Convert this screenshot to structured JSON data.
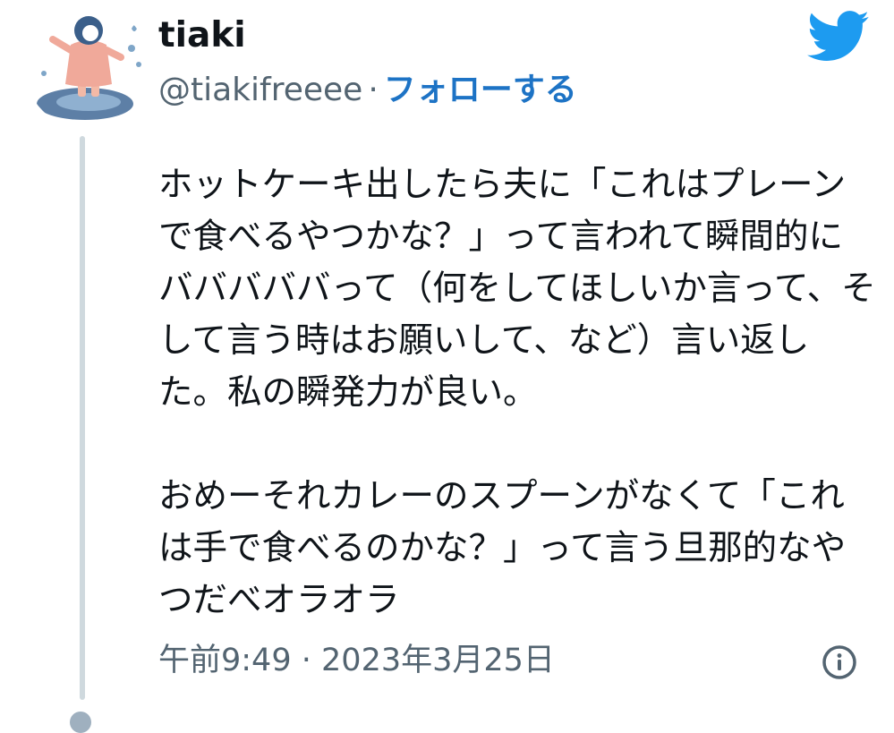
{
  "author": {
    "display_name": "tiaki",
    "handle": "@tiakifreeee",
    "separator": "·",
    "follow_label": "フォローする",
    "avatar_icon": "profile-avatar-girl-in-puddle"
  },
  "brand": {
    "logo_icon": "twitter-bird-icon",
    "color": "#1d9bf0"
  },
  "tweet": {
    "paragraph1": "ホットケーキ出したら夫に「これはプレーン\nで食べるやつかな？」って言われて瞬間的に\nバババババって（何をしてほしいか言って、そ\nして言う時はお願いして、など）言い返し\nた。私の瞬発力が良い。",
    "paragraph2": "おめーそれカレーのスプーンがなくて「これ\nは手で食べるのかな？」って言う旦那的なや\nつだべオラオラ"
  },
  "meta": {
    "time": "午前9:49",
    "separator": "·",
    "date": "2023年3月25日",
    "info_icon": "info-icon"
  },
  "colors": {
    "link": "#1d73c5",
    "secondary_text": "#536471",
    "thread_line": "#cfd9de"
  }
}
